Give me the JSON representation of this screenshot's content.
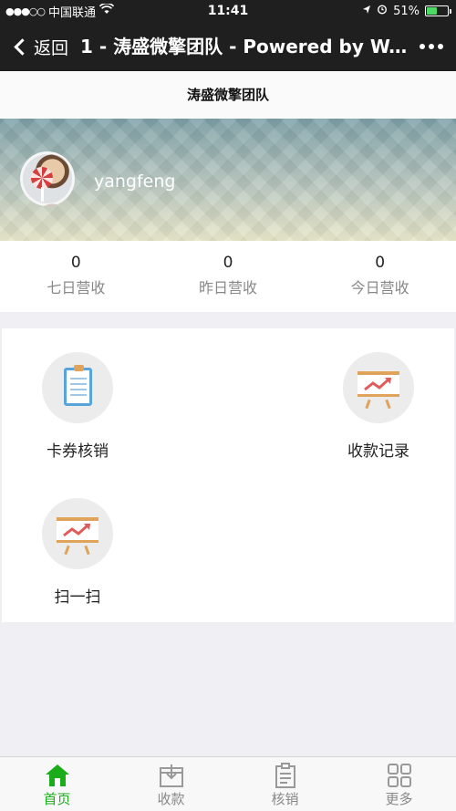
{
  "status_bar": {
    "carrier": "中国联通",
    "signal": "●●●○○",
    "time": "11:41",
    "battery": "51%",
    "battery_level": 0.51
  },
  "nav": {
    "back_label": "返回",
    "title": "1 - 涛盛微擎团队 - Powered by W..."
  },
  "page": {
    "header_title": "涛盛微擎团队"
  },
  "profile": {
    "username": "yangfeng"
  },
  "stats": [
    {
      "value": "0",
      "label": "七日营收"
    },
    {
      "value": "0",
      "label": "昨日营收"
    },
    {
      "value": "0",
      "label": "今日营收"
    }
  ],
  "menu": [
    {
      "label": "卡券核销",
      "icon": "clipboard-icon"
    },
    {
      "label": "收款记录",
      "icon": "chart-easel-icon"
    },
    {
      "label": "扫一扫",
      "icon": "chart-easel-icon"
    }
  ],
  "tabbar": [
    {
      "label": "首页",
      "icon": "home-icon",
      "active": true
    },
    {
      "label": "收款",
      "icon": "inbox-icon",
      "active": false
    },
    {
      "label": "核销",
      "icon": "clipboard-icon",
      "active": false
    },
    {
      "label": "更多",
      "icon": "grid-icon",
      "active": false
    }
  ],
  "colors": {
    "nav_background": "#1f1f1f",
    "active_tab": "#1aad19",
    "battery_fill": "#4cd964"
  }
}
